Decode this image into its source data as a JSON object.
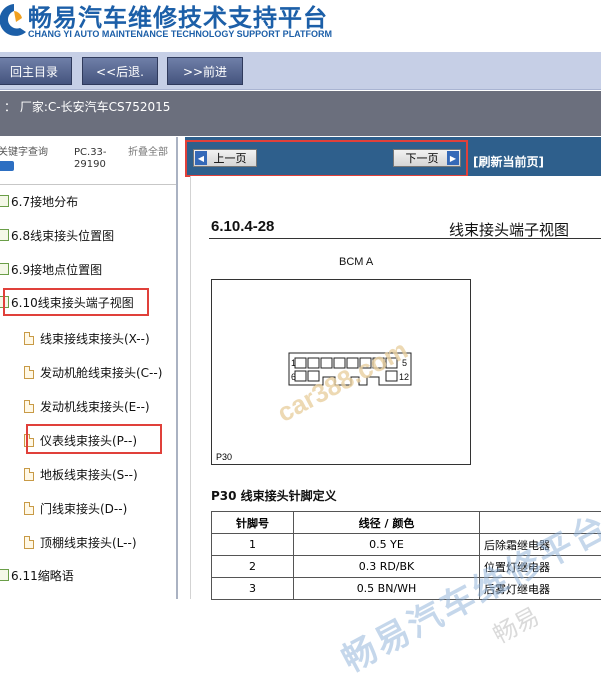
{
  "header": {
    "brand_cn": "畅易汽车维修技术支持平台",
    "brand_en": "CHANG YI AUTO MAINTENANCE TECHNOLOGY SUPPORT PLATFORM",
    "brand_color": "#1c5fa8"
  },
  "toolbar": {
    "home_label": "回主目录",
    "back_label": "<<后退.",
    "forward_label": ">>前进"
  },
  "breadcrumb": {
    "text": "： 厂家:C-长安汽车CS752015"
  },
  "left_tabs": {
    "keyword": "关键字查询",
    "pc": "PC.33-29190",
    "collapse": "折叠全部"
  },
  "tree": [
    {
      "label": "6.7接地分布"
    },
    {
      "label": "6.8线束接头位置图"
    },
    {
      "label": "6.9接地点位置图"
    },
    {
      "label": "6.10线束接头端子视图"
    },
    {
      "label": "线束接线束接头(X--)"
    },
    {
      "label": "发动机舱线束接头(C--)"
    },
    {
      "label": "发动机线束接头(E--)"
    },
    {
      "label": "仪表线束接头(P--)"
    },
    {
      "label": "地板线束接头(S--)"
    },
    {
      "label": "门线束接头(D--)"
    },
    {
      "label": "顶棚线束接头(L--)"
    },
    {
      "label": "6.11缩略语"
    }
  ],
  "pager": {
    "prev_label": "上一页",
    "next_label": "下一页",
    "refresh_label": "[刷新当前页]",
    "bar_color": "#2e5f8c"
  },
  "doc": {
    "section": "6.10.4-28",
    "title": "线束接头端子视图",
    "bcm_label": "BCM A",
    "pin_labels": [
      "1",
      "6",
      "5",
      "12"
    ],
    "connector_label": "P30",
    "pin_heading": "P30 线束接头针脚定义",
    "table_headers": [
      "针脚号",
      "线径 / 颜色",
      ""
    ],
    "table_rows": [
      {
        "pin": "1",
        "wire": "0.5 YE",
        "desc": "后除霜继电器"
      },
      {
        "pin": "2",
        "wire": "0.3 RD/BK",
        "desc": "位置灯继电器"
      },
      {
        "pin": "3",
        "wire": "0.5 BN/WH",
        "desc": "后雾灯继电器"
      }
    ]
  },
  "watermarks": {
    "site": "car388.com",
    "platform": "畅易汽车维修平台",
    "short": "畅易"
  },
  "colors": {
    "highlight": "#e0403a",
    "toolbar_bg": "#c6cfe6",
    "crumb_bg": "#6b6f7d"
  }
}
